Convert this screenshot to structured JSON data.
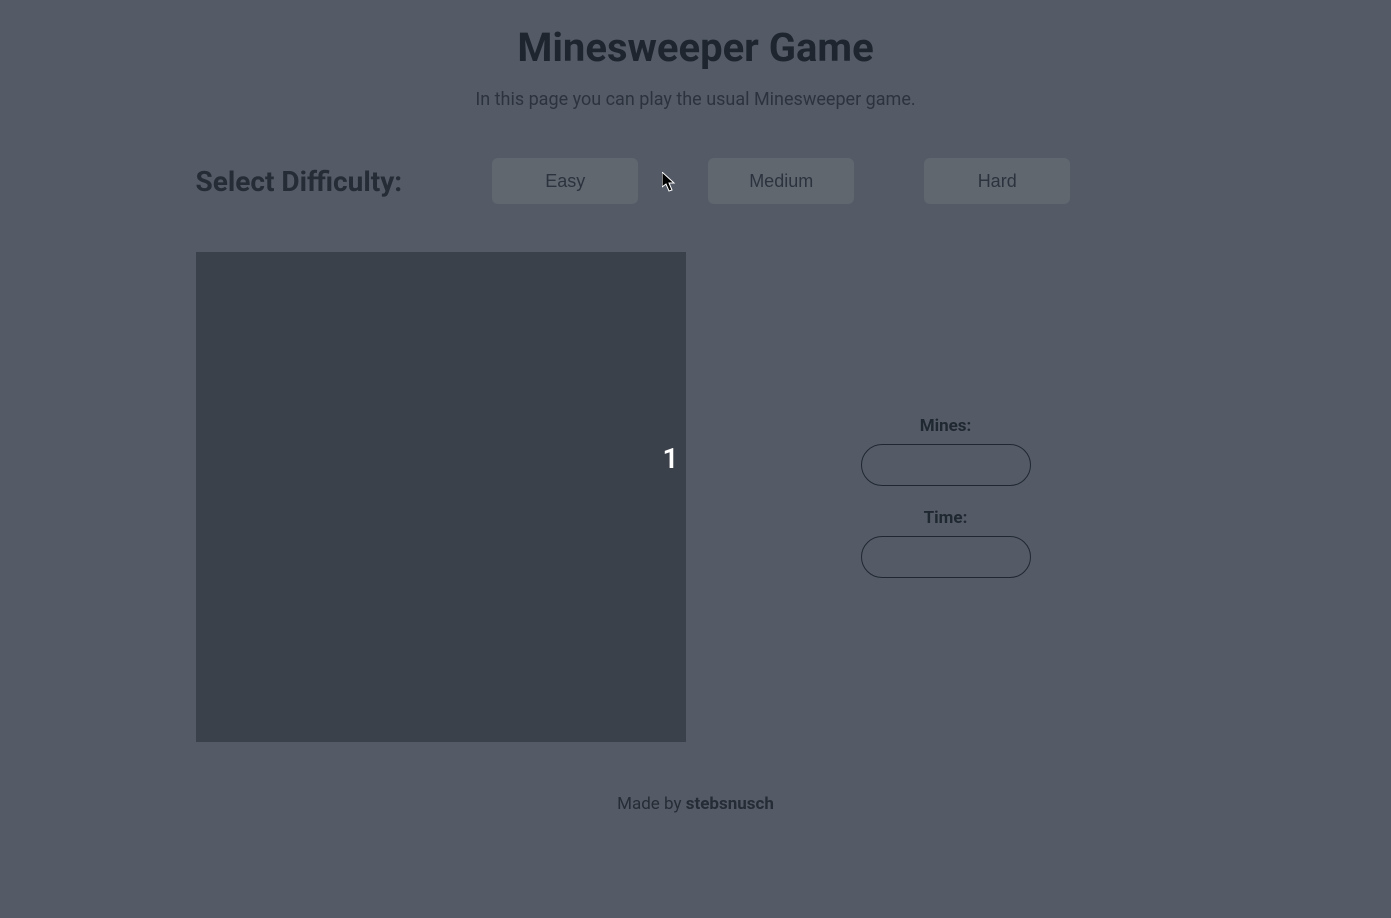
{
  "header": {
    "title": "Minesweeper Game",
    "subtitle": "In this page you can play the usual Minesweeper game."
  },
  "difficulty": {
    "label": "Select Difficulty:",
    "options": [
      "Easy",
      "Medium",
      "Hard"
    ]
  },
  "board": {
    "visible_number": "1"
  },
  "stats": {
    "mines_label": "Mines:",
    "mines_value": "",
    "time_label": "Time:",
    "time_value": ""
  },
  "footer": {
    "prefix": "Made by ",
    "author": "stebsnusch"
  }
}
